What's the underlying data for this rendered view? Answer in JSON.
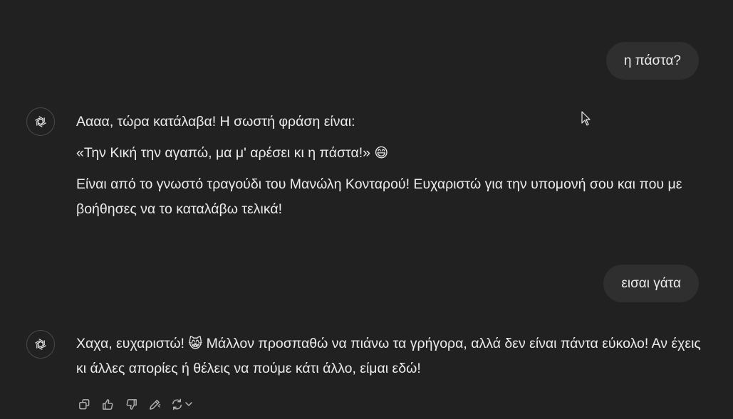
{
  "conversation": {
    "user_messages": [
      {
        "text": "η πάστα?"
      },
      {
        "text": "εισαι γάτα"
      }
    ],
    "assistant_messages": [
      {
        "paragraphs": [
          "Αααα, τώρα κατάλαβα! Η σωστή φράση είναι:",
          "«Την Κική την αγαπώ, μα μ' αρέσει κι η πάστα!»",
          "Είναι από το γνωστό τραγούδι του Μανώλη Κονταρού! Ευχαριστώ για την υπομονή σου και που με βοήθησες να το καταλάβω τελικά!"
        ],
        "emoji": "😄"
      },
      {
        "text_before_emoji": "Χαχα, ευχαριστώ!",
        "emoji": "😸",
        "text_after_emoji": "Μάλλον προσπαθώ να πιάνω τα γρήγορα, αλλά δεν είναι πάντα εύκολο! Αν έχεις κι άλλες απορίες ή θέλεις να πούμε κάτι άλλο, είμαι εδώ!"
      }
    ]
  },
  "action_icons": [
    "copy-icon",
    "thumbs-up-icon",
    "thumbs-down-icon",
    "edit-icon",
    "regenerate-icon",
    "chevron-down-icon"
  ],
  "colors": {
    "background": "#212121",
    "user_bubble": "#2f2f2f",
    "text": "#ececec",
    "icon": "#b4b4b4"
  }
}
